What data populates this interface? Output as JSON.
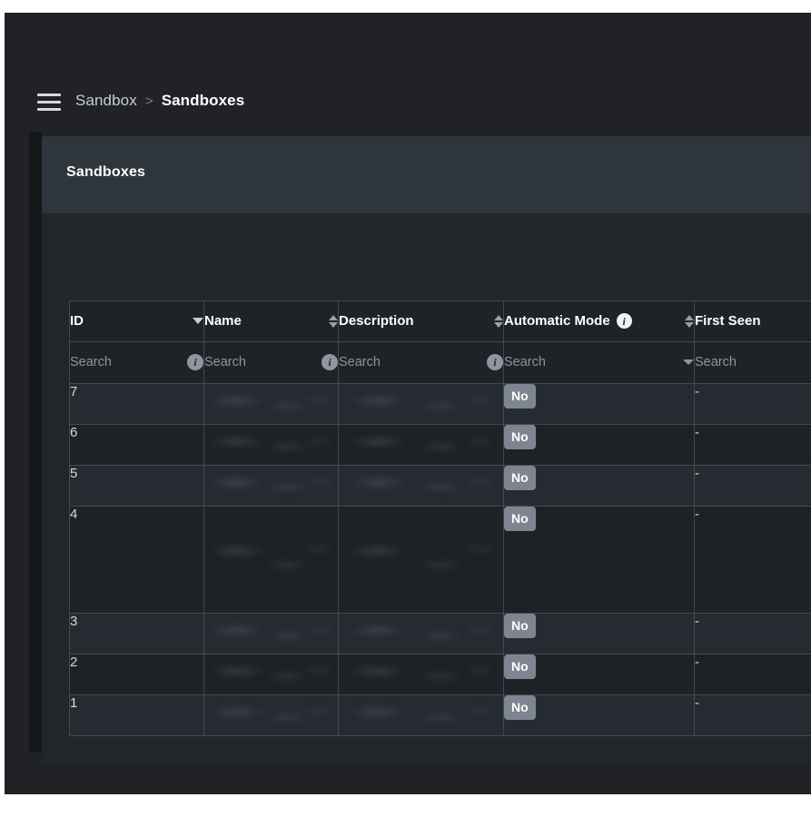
{
  "app": {
    "background_color": "#202226",
    "page_background": "#ffffff"
  },
  "topnav": {
    "menu_icon": "hamburger-menu-icon",
    "breadcrumb": {
      "parent": "Sandbox",
      "separator": ">",
      "current": "Sandboxes"
    }
  },
  "panel": {
    "title": "Sandboxes",
    "header_color": "#2f353c",
    "body_color": "#22262b"
  },
  "table": {
    "columns": [
      {
        "key": "id",
        "label": "ID",
        "sort": "desc",
        "has_info": false,
        "filter": {
          "placeholder": "Search",
          "control": "info"
        }
      },
      {
        "key": "name",
        "label": "Name",
        "sort": "both",
        "has_info": false,
        "filter": {
          "placeholder": "Search",
          "control": "info"
        }
      },
      {
        "key": "desc",
        "label": "Description",
        "sort": "both",
        "has_info": false,
        "filter": {
          "placeholder": "Search",
          "control": "info"
        }
      },
      {
        "key": "auto",
        "label": "Automatic Mode",
        "sort": "both",
        "has_info": true,
        "filter": {
          "placeholder": "Search",
          "control": "dropdown"
        }
      },
      {
        "key": "seen",
        "label": "First Seen",
        "sort": "none",
        "has_info": false,
        "filter": {
          "placeholder": "Search",
          "control": "none"
        }
      }
    ],
    "info_glyph": "i",
    "rows": [
      {
        "id": "7",
        "name": "",
        "desc": "",
        "auto": "No",
        "seen": "-",
        "redacted": true,
        "tall": false
      },
      {
        "id": "6",
        "name": "",
        "desc": "",
        "auto": "No",
        "seen": "-",
        "redacted": true,
        "tall": false
      },
      {
        "id": "5",
        "name": "",
        "desc": "",
        "auto": "No",
        "seen": "-",
        "redacted": true,
        "tall": false
      },
      {
        "id": "4",
        "name": "",
        "desc": "",
        "auto": "No",
        "seen": "-",
        "redacted": true,
        "tall": true
      },
      {
        "id": "3",
        "name": "",
        "desc": "",
        "auto": "No",
        "seen": "-",
        "redacted": true,
        "tall": false
      },
      {
        "id": "2",
        "name": "",
        "desc": "",
        "auto": "No",
        "seen": "-",
        "redacted": true,
        "tall": false
      },
      {
        "id": "1",
        "name": "",
        "desc": "",
        "auto": "No",
        "seen": "-",
        "redacted": true,
        "tall": false
      }
    ],
    "badge_color": "#7d8590",
    "border_color": "#44494f"
  }
}
